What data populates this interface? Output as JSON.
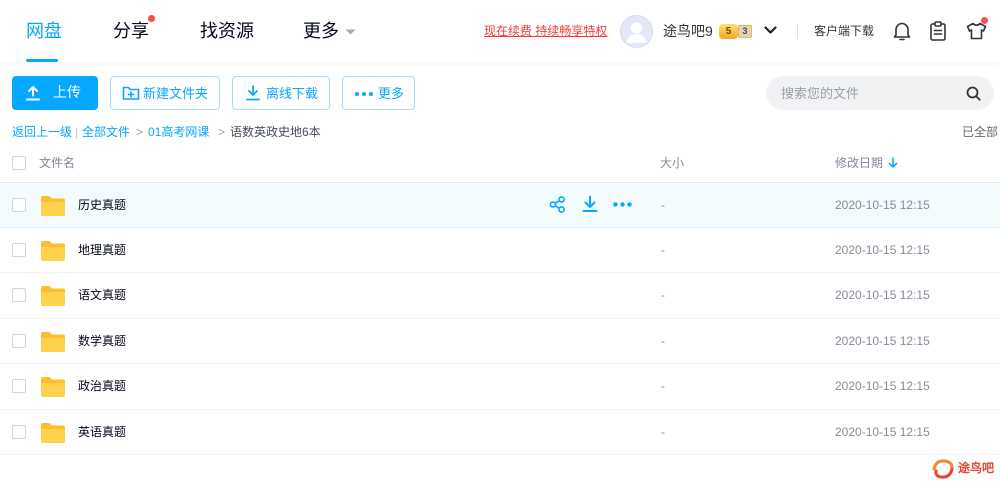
{
  "nav": {
    "tabs": [
      {
        "label": "网盘",
        "active": true,
        "has_dot": false
      },
      {
        "label": "分享",
        "active": false,
        "has_dot": true
      },
      {
        "label": "找资源",
        "active": false,
        "has_dot": false
      },
      {
        "label": "更多",
        "active": false,
        "has_dot": false,
        "dropdown": true
      }
    ],
    "promo_link": "现在续费 持续畅享特权",
    "user": {
      "name": "途鸟吧9",
      "avatar_icon": "user-avatar-icon",
      "badge_primary": "5",
      "badge_secondary": "3"
    },
    "client_download": "客户端下载",
    "icons": {
      "notifications": "bell-icon",
      "tasks": "clipboard-icon",
      "skin": "tshirt-icon"
    },
    "skin_has_dot": true
  },
  "toolbar": {
    "upload": {
      "label": "上传",
      "icon": "upload-icon"
    },
    "new_folder": {
      "label": "新建文件夹",
      "icon": "folder-plus-icon"
    },
    "offline_download": {
      "label": "离线下载",
      "icon": "download-icon"
    },
    "more": {
      "label": "更多",
      "icon": "more-dots-icon"
    },
    "search": {
      "placeholder": "搜索您的文件",
      "value": "",
      "icon": "search-icon"
    }
  },
  "breadcrumb": {
    "back": "返回上一级",
    "divider": "|",
    "arrow": ">",
    "items": [
      "全部文件",
      "01高考网课",
      "语数英政史地6本"
    ],
    "load_status": "已全部"
  },
  "file_list": {
    "columns": {
      "name": "文件名",
      "size": "大小",
      "modified": "修改日期"
    },
    "sorted_by_modified_desc": true,
    "row_actions": [
      "share-icon",
      "download-icon",
      "more-dots-icon"
    ],
    "rows": [
      {
        "name": "历史真题",
        "icon": "folder-icon",
        "size": "-",
        "modified": "2020-10-15 12:15",
        "hovered": true
      },
      {
        "name": "地理真题",
        "icon": "folder-icon",
        "size": "-",
        "modified": "2020-10-15 12:15",
        "hovered": false
      },
      {
        "name": "语文真题",
        "icon": "folder-icon",
        "size": "-",
        "modified": "2020-10-15 12:15",
        "hovered": false
      },
      {
        "name": "数学真题",
        "icon": "folder-icon",
        "size": "-",
        "modified": "2020-10-15 12:15",
        "hovered": false
      },
      {
        "name": "政治真题",
        "icon": "folder-icon",
        "size": "-",
        "modified": "2020-10-15 12:15",
        "hovered": false
      },
      {
        "name": "英语真题",
        "icon": "folder-icon",
        "size": "-",
        "modified": "2020-10-15 12:15",
        "hovered": false
      }
    ]
  },
  "watermark": {
    "text": "途鸟吧",
    "icon": "swirl-logo-icon"
  },
  "colors": {
    "accent": "#06a7ff",
    "promo": "#f33a3a",
    "notification_dot": "#f5504f",
    "folder": "#ffd24d",
    "row_hover": "#f4fbff",
    "search_bg": "#f1f2f4"
  }
}
